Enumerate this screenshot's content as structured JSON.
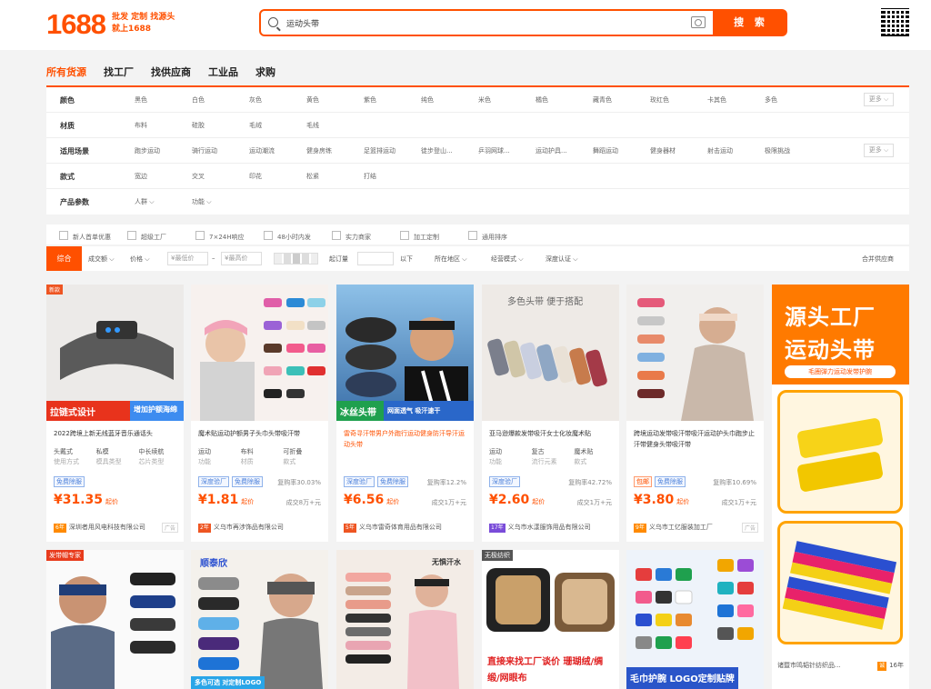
{
  "header": {
    "logo": "1688",
    "slogan_line1": "批发 定制 找源头",
    "slogan_line2": "就上1688",
    "search_query": "运动头带",
    "search_button": "搜 索"
  },
  "nav": [
    "所有货源",
    "找工厂",
    "找供应商",
    "工业品",
    "求购"
  ],
  "filters": {
    "color_label": "颜色",
    "colors": [
      "黑色",
      "白色",
      "灰色",
      "黄色",
      "紫色",
      "纯色",
      "米色",
      "橘色",
      "藏青色",
      "玫红色",
      "卡其色",
      "多色"
    ],
    "material_label": "材质",
    "materials": [
      "布料",
      "硅胶",
      "毛绒",
      "毛线"
    ],
    "scene_label": "适用场景",
    "scenes": [
      "跑步运动",
      "骑行运动",
      "运动潮流",
      "健身房练",
      "足篮排运动",
      "徒步登山...",
      "乒羽网球...",
      "运动护具...",
      "舞蹈运动",
      "健身器材",
      "射击运动",
      "极限挑战"
    ],
    "style_label": "款式",
    "styles": [
      "宽边",
      "交叉",
      "印花",
      "松紧",
      "打结"
    ],
    "param_label": "产品参数",
    "params": [
      "人群",
      "功能"
    ],
    "more": "更多"
  },
  "checks": [
    "新人首单优惠",
    "超级工厂",
    "7×24H响应",
    "48小时内发",
    "实力商家",
    "加工定制",
    "通用排序"
  ],
  "sortbar": {
    "active": "综合",
    "items": [
      "成交额",
      "价格"
    ],
    "price_min": "¥最低价",
    "dash": "–",
    "price_max": "¥最高价",
    "qty_label": "起订量",
    "qty_suffix": "以下",
    "location": "所在地区",
    "model": "经营模式",
    "cert": "深度认证",
    "merge": "合并供应商"
  },
  "cards": [
    {
      "title": "2022跨境上新无线蓝牙音乐通话头",
      "attrs": [
        [
          "头戴式",
          "使用方式"
        ],
        [
          "私模",
          "模具类型"
        ],
        [
          "中长续航",
          "芯片类型"
        ]
      ],
      "tags": [
        "免费除服"
      ],
      "rep": "",
      "price": "¥31.35",
      "unit": "起价",
      "sold": "",
      "years": "6年",
      "supplier": "深圳者用风电科技有限公司",
      "ad": "广告",
      "banner": "拉链式设计 增加护额海绵"
    },
    {
      "title": "魔术贴运动护额男子头巾头带吸汗带",
      "attrs": [
        [
          "运动",
          "功能"
        ],
        [
          "布料",
          "材质"
        ],
        [
          "可折叠",
          "款式"
        ]
      ],
      "tags": [
        "深度验厂",
        "免费除服"
      ],
      "rep": "复购率30.03%",
      "price": "¥1.81",
      "unit": "起价",
      "sold": "成交8万+元",
      "years": "2年",
      "supplier": "义乌市再涉饰品有限公司",
      "ad": "",
      "banner": ""
    },
    {
      "title": "雷奇寻汗带男户外跑行运动健身防汗导汗运动头带",
      "attrs": [],
      "tags": [
        "深度验厂",
        "免费除服"
      ],
      "rep": "复购率12.2%",
      "price": "¥6.56",
      "unit": "起价",
      "sold": "成交1万+元",
      "years": "5年",
      "supplier": "义乌市雷奇体育用品有限公司",
      "ad": "",
      "banner": "冰丝头带 网面透气 吸汗速干"
    },
    {
      "title": "亚马逊爆款发带吸汗女士化妆魔术贴",
      "attrs": [
        [
          "运动",
          "功能"
        ],
        [
          "复古",
          "流行元素"
        ],
        [
          "魔术贴",
          "款式"
        ]
      ],
      "tags": [
        "深度验厂"
      ],
      "rep": "复购率42.72%",
      "price": "¥2.60",
      "unit": "起价",
      "sold": "成交1万+元",
      "years": "17年",
      "supplier": "义乌市水漾服饰用品有限公司",
      "ad": "",
      "banner": "多色头带 便于搭配"
    },
    {
      "title": "跨境运动发带吸汗带吸汗运动护头巾跑步止汗带健身头带吸汗带",
      "attrs": [],
      "tags": [
        "包邮",
        "免费除服"
      ],
      "rep": "复购率10.69%",
      "price": "¥3.80",
      "unit": "起价",
      "sold": "成交1万+元",
      "years": "9年",
      "supplier": "义乌市工亿服装加工厂",
      "ad": "广告",
      "banner": ""
    }
  ],
  "cards2": [
    {
      "badge": "发带帽专家",
      "banner": ""
    },
    {
      "badge": "",
      "banner": "多色可选 对定制LOGO"
    },
    {
      "badge": "",
      "banner": "无惧汗水"
    },
    {
      "badge": "无极纺织",
      "banner": "直接来找工厂谈价 珊瑚绒/绸缎/网眼布"
    },
    {
      "badge": "",
      "banner": "毛巾护腕 LOGO定制贴牌"
    }
  ],
  "side_ad": {
    "line1": "源头工厂",
    "line2": "运动头带",
    "line3": "毛圈弹力运动发带护腕",
    "supplier": "诸暨市鸣韬针纺织品...",
    "years": "16年"
  }
}
